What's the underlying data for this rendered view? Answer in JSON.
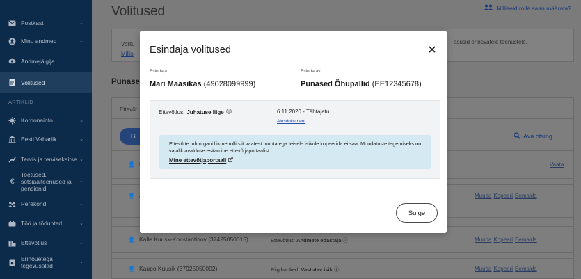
{
  "sidebar": {
    "items": [
      {
        "label": "Postkast",
        "icon": "mail-icon"
      },
      {
        "label": "Minu andmed",
        "icon": "user-icon"
      },
      {
        "label": "Andmejälgija",
        "icon": "eye-icon"
      },
      {
        "label": "Volitused",
        "icon": "document-icon"
      },
      {
        "label": "Koroonainfo",
        "icon": "virus-icon"
      },
      {
        "label": "Eesti Vabariik",
        "icon": "government-icon"
      },
      {
        "label": "Tervis ja tervisekaitse",
        "icon": "health-icon"
      },
      {
        "label": "Toetused, sotsiaalteenused ja pensionid",
        "icon": "euro-icon"
      },
      {
        "label": "Perekond",
        "icon": "family-icon"
      },
      {
        "label": "Töö ja tööuhted",
        "icon": "briefcase-icon"
      },
      {
        "label": "Ettevõtlus",
        "icon": "building-icon"
      },
      {
        "label": "Erinõuetega tegevusalad",
        "icon": "permit-icon"
      }
    ],
    "section_label": "ARTIKLID"
  },
  "page": {
    "title": "Volitused",
    "roles_link": "Milliseid rolle saan määrata?",
    "info_left_1": "Volitu",
    "info_left_2": "Millis",
    "info_right": "äsusid erinevatele teenustele.",
    "section_title": "Punase",
    "tab_label": "Ettevõt",
    "add_button": "Li",
    "search_link": "Ava otsing",
    "rows": [
      {
        "name": "M",
        "role": "",
        "actions": [
          "Vaata"
        ]
      },
      {
        "name": "J",
        "role": "",
        "actions": [
          "Muuda",
          "Kopeeri",
          "Eemalda"
        ]
      },
      {
        "name": "Kalle Kuusk-Konstantinov (37425050015)",
        "role": "Ettevõtlus: ",
        "role_bold": "Andmete edastaja",
        "actions": [
          "Muuda",
          "Kopeeri",
          "Eemalda"
        ]
      },
      {
        "name": "Kaupo Kuusik (37925050002)",
        "role": "Riigihanked: ",
        "role_bold": "Vastutav isik",
        "actions": [
          "Muuda",
          "Kopeeri",
          "Eemalda"
        ]
      }
    ]
  },
  "modal": {
    "title": "Esindaja volitused",
    "representative_label": "Esindaja",
    "representative_name": "Mari Maasikas",
    "representative_code": "(49028099999)",
    "represented_label": "Esindatav",
    "represented_name": "Punased Õhupallid",
    "represented_code": "(EE12345678)",
    "business_prefix": "Ettevõtlus: ",
    "business_role": "Juhatuse liige",
    "deadline": "6.11.2020 - Tähtajatu",
    "doc_link": "Alusdokument",
    "notice": "Ettevõtte juhtorgani liikme rolli siit vaatest muuta ega teisele isikule kopeerida ei saa. Muudatuste tegemiseks on vajalik avalduse esitamine ettevõtjaportaalist.",
    "notice_link": "Mine ettevõtjaportaali",
    "close_button": "Sulge"
  },
  "colors": {
    "sidebar_bg": "#0c2a4a",
    "notice_bg": "#d5e9f2",
    "link": "#1f4fa8"
  }
}
